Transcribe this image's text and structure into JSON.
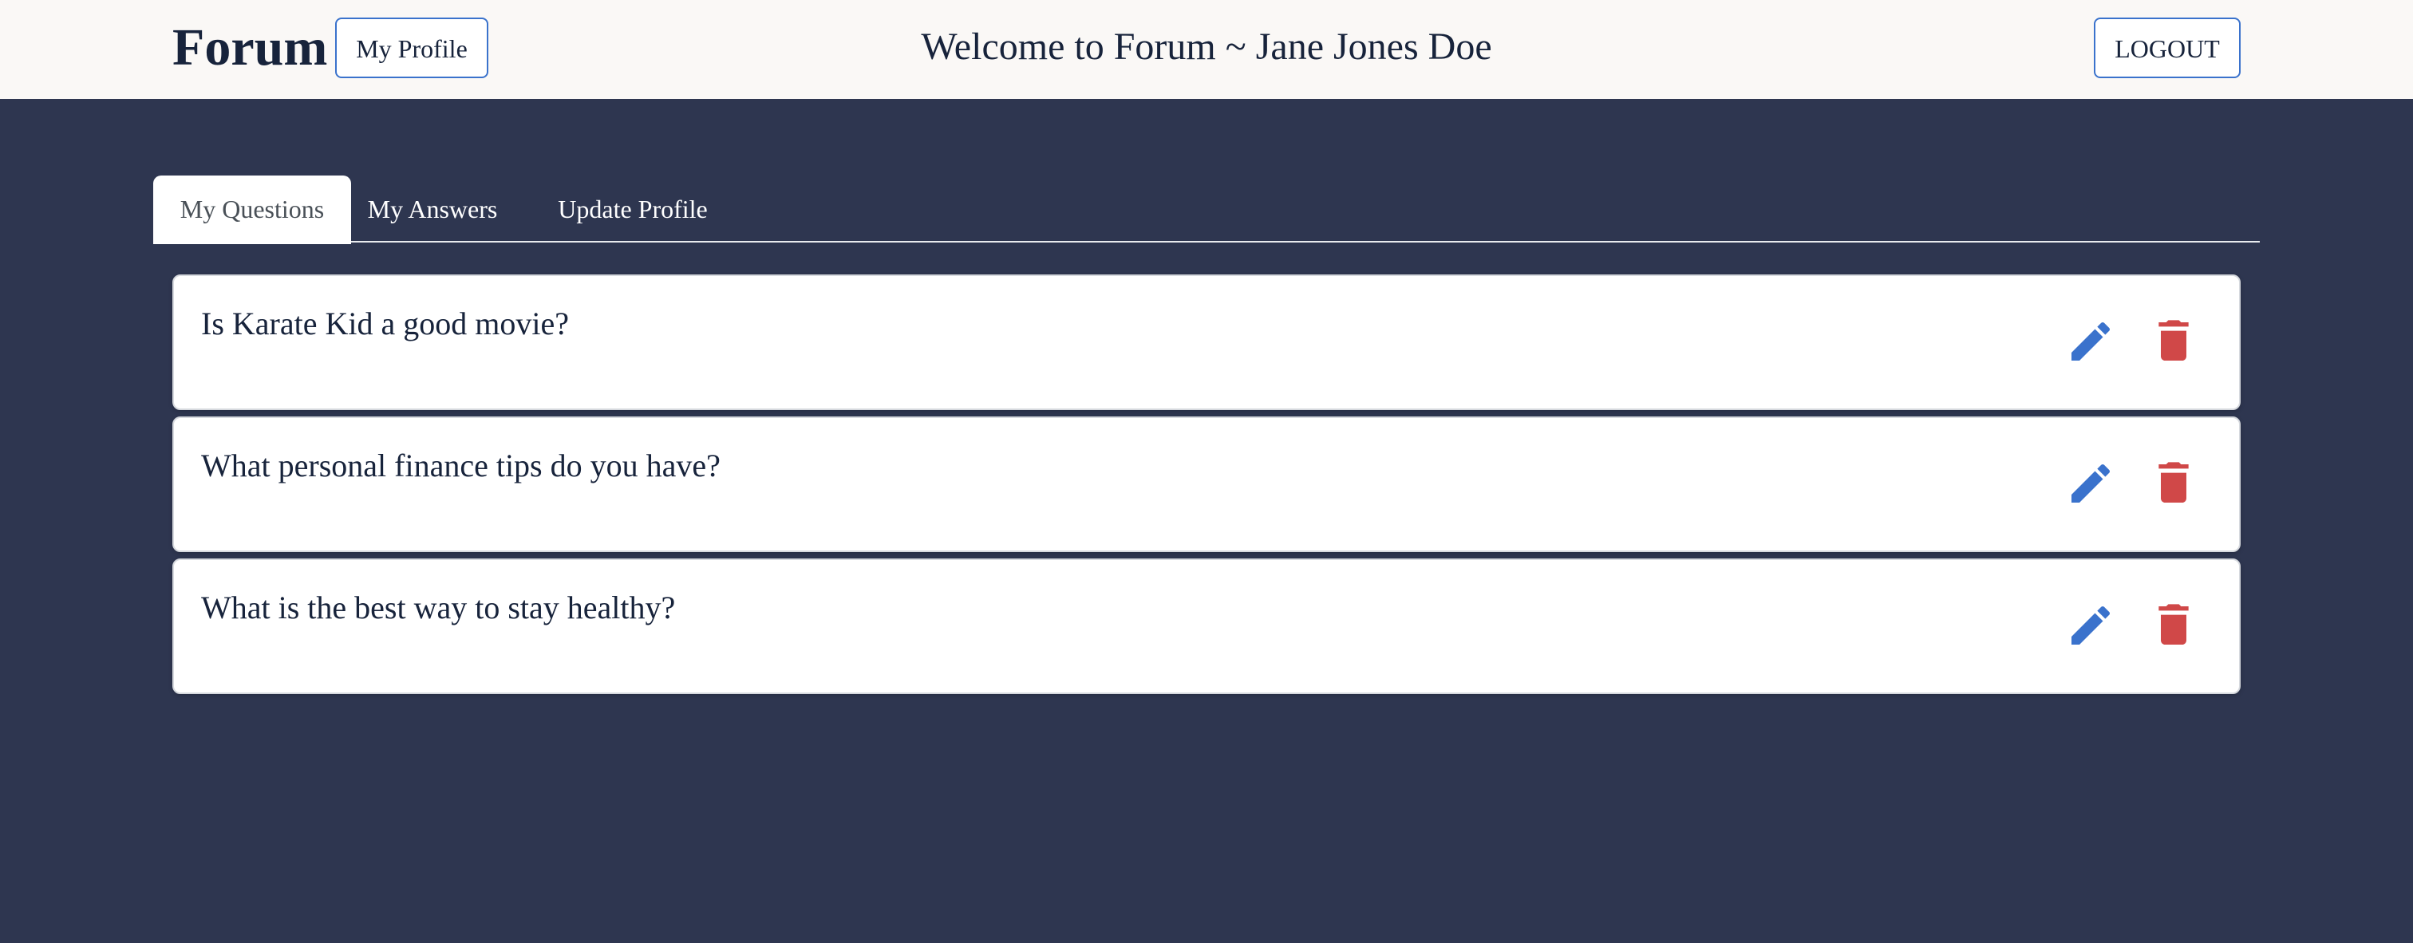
{
  "header": {
    "brand": "Forum",
    "profile_button": "My Profile",
    "welcome": "Welcome to Forum ~ Jane Jones Doe",
    "logout_button": "LOGOUT"
  },
  "tabs": [
    {
      "label": "My Questions",
      "active": true
    },
    {
      "label": "My Answers",
      "active": false
    },
    {
      "label": "Update Profile",
      "active": false
    }
  ],
  "questions": [
    {
      "title": "Is Karate Kid a good movie?",
      "edit_icon": "pencil-icon",
      "delete_icon": "trash-icon"
    },
    {
      "title": "What personal finance tips do you have?",
      "edit_icon": "pencil-icon",
      "delete_icon": "trash-icon"
    },
    {
      "title": "What is the best way to stay healthy?",
      "edit_icon": "pencil-icon",
      "delete_icon": "trash-icon"
    }
  ],
  "colors": {
    "page_background": "#2e3650",
    "navbar_background": "#faf8f6",
    "text_primary": "#17233b",
    "accent_blue": "#3a72cc",
    "edit_icon": "#3a72cc",
    "delete_icon": "#d04848"
  }
}
